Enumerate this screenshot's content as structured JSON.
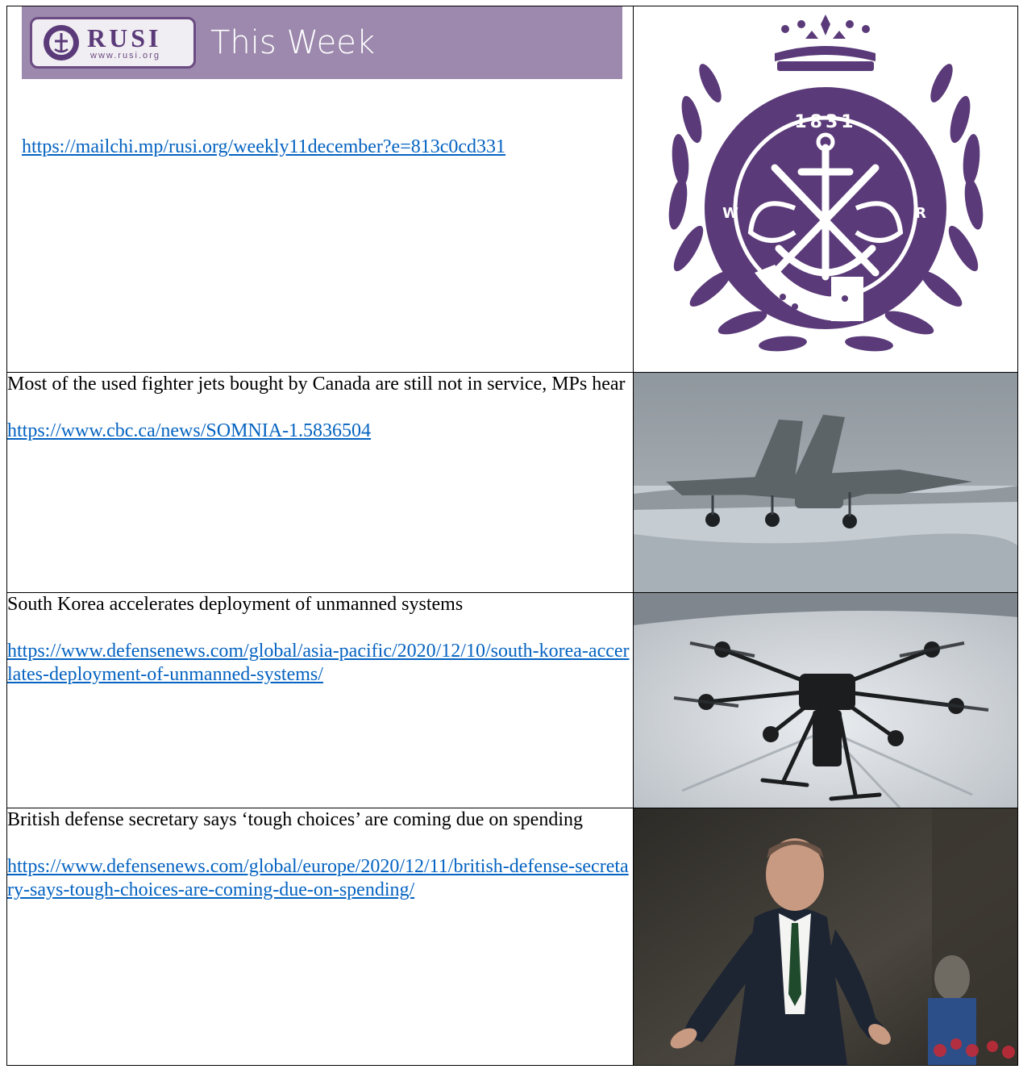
{
  "header": {
    "logo_name": "RUSI",
    "logo_url": "www.rusi.org",
    "banner_title": "This Week",
    "link": "https://mailchi.mp/rusi.org/weekly11december?e=813c0cd331",
    "seal_year": "1831",
    "seal_left_letter": "W",
    "seal_right_letter": "R"
  },
  "articles": [
    {
      "headline": "Most of the used fighter jets bought by Canada are still not in service, MPs hear",
      "link": "https://www.cbc.ca/news/SOMNIA-1.5836504",
      "image": "fighter-jet-photo"
    },
    {
      "headline": "South Korea accelerates deployment of unmanned systems",
      "link": "https://www.defensenews.com/global/asia-pacific/2020/12/10/south-korea-accerlates-deployment-of-unmanned-systems/",
      "image": "drone-photo"
    },
    {
      "headline": "British defense secretary says ‘tough choices’ are coming due on spending",
      "link": "https://www.defensenews.com/global/europe/2020/12/11/british-defense-secretary-says-tough-choices-are-coming-due-on-spending/",
      "image": "defense-secretary-photo"
    }
  ],
  "colors": {
    "banner": "#9c89ad",
    "purple": "#5a3a78",
    "link": "#0563c1"
  }
}
